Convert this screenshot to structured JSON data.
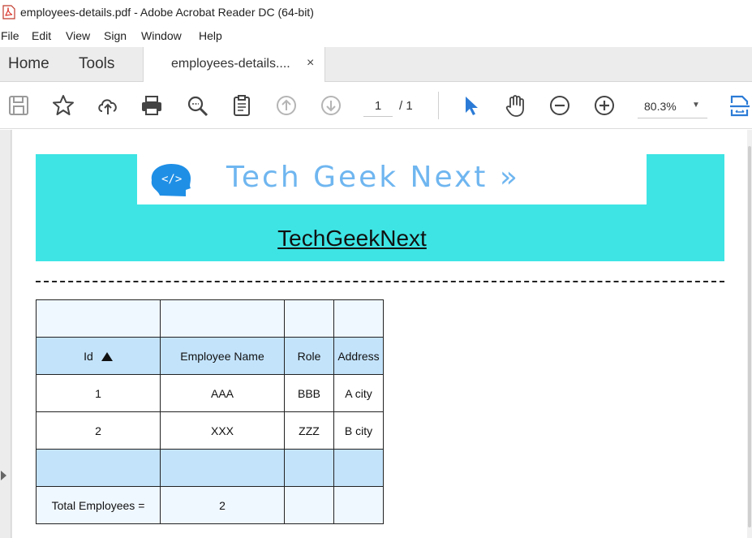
{
  "window": {
    "title": "employees-details.pdf - Adobe Acrobat Reader DC (64-bit)"
  },
  "menu": [
    "File",
    "Edit",
    "View",
    "Sign",
    "Window",
    "Help"
  ],
  "tabs": {
    "home": "Home",
    "tools": "Tools",
    "document": "employees-details....",
    "close": "×"
  },
  "toolbar": {
    "page_current": "1",
    "page_total": "/ 1",
    "zoom": "80.3%",
    "zoom_dropdown": "▼"
  },
  "document": {
    "logo_text": "Tech Geek Next »",
    "logo_tag": "</>",
    "title": "TechGeekNext",
    "table": {
      "headers": [
        "Id",
        "Employee Name",
        "Role",
        "Address"
      ],
      "rows": [
        [
          "1",
          "AAA",
          "BBB",
          "A city"
        ],
        [
          "2",
          "XXX",
          "ZZZ",
          "B city"
        ]
      ],
      "footer_label": "Total Employees =",
      "footer_value": "2"
    }
  },
  "colors": {
    "banner": "#3ee4e4",
    "header_row": "#c3e3fb",
    "light_row": "#f0f8ff",
    "logo": "#6fb6f0",
    "toolbar_blue": "#2b7bd6"
  }
}
